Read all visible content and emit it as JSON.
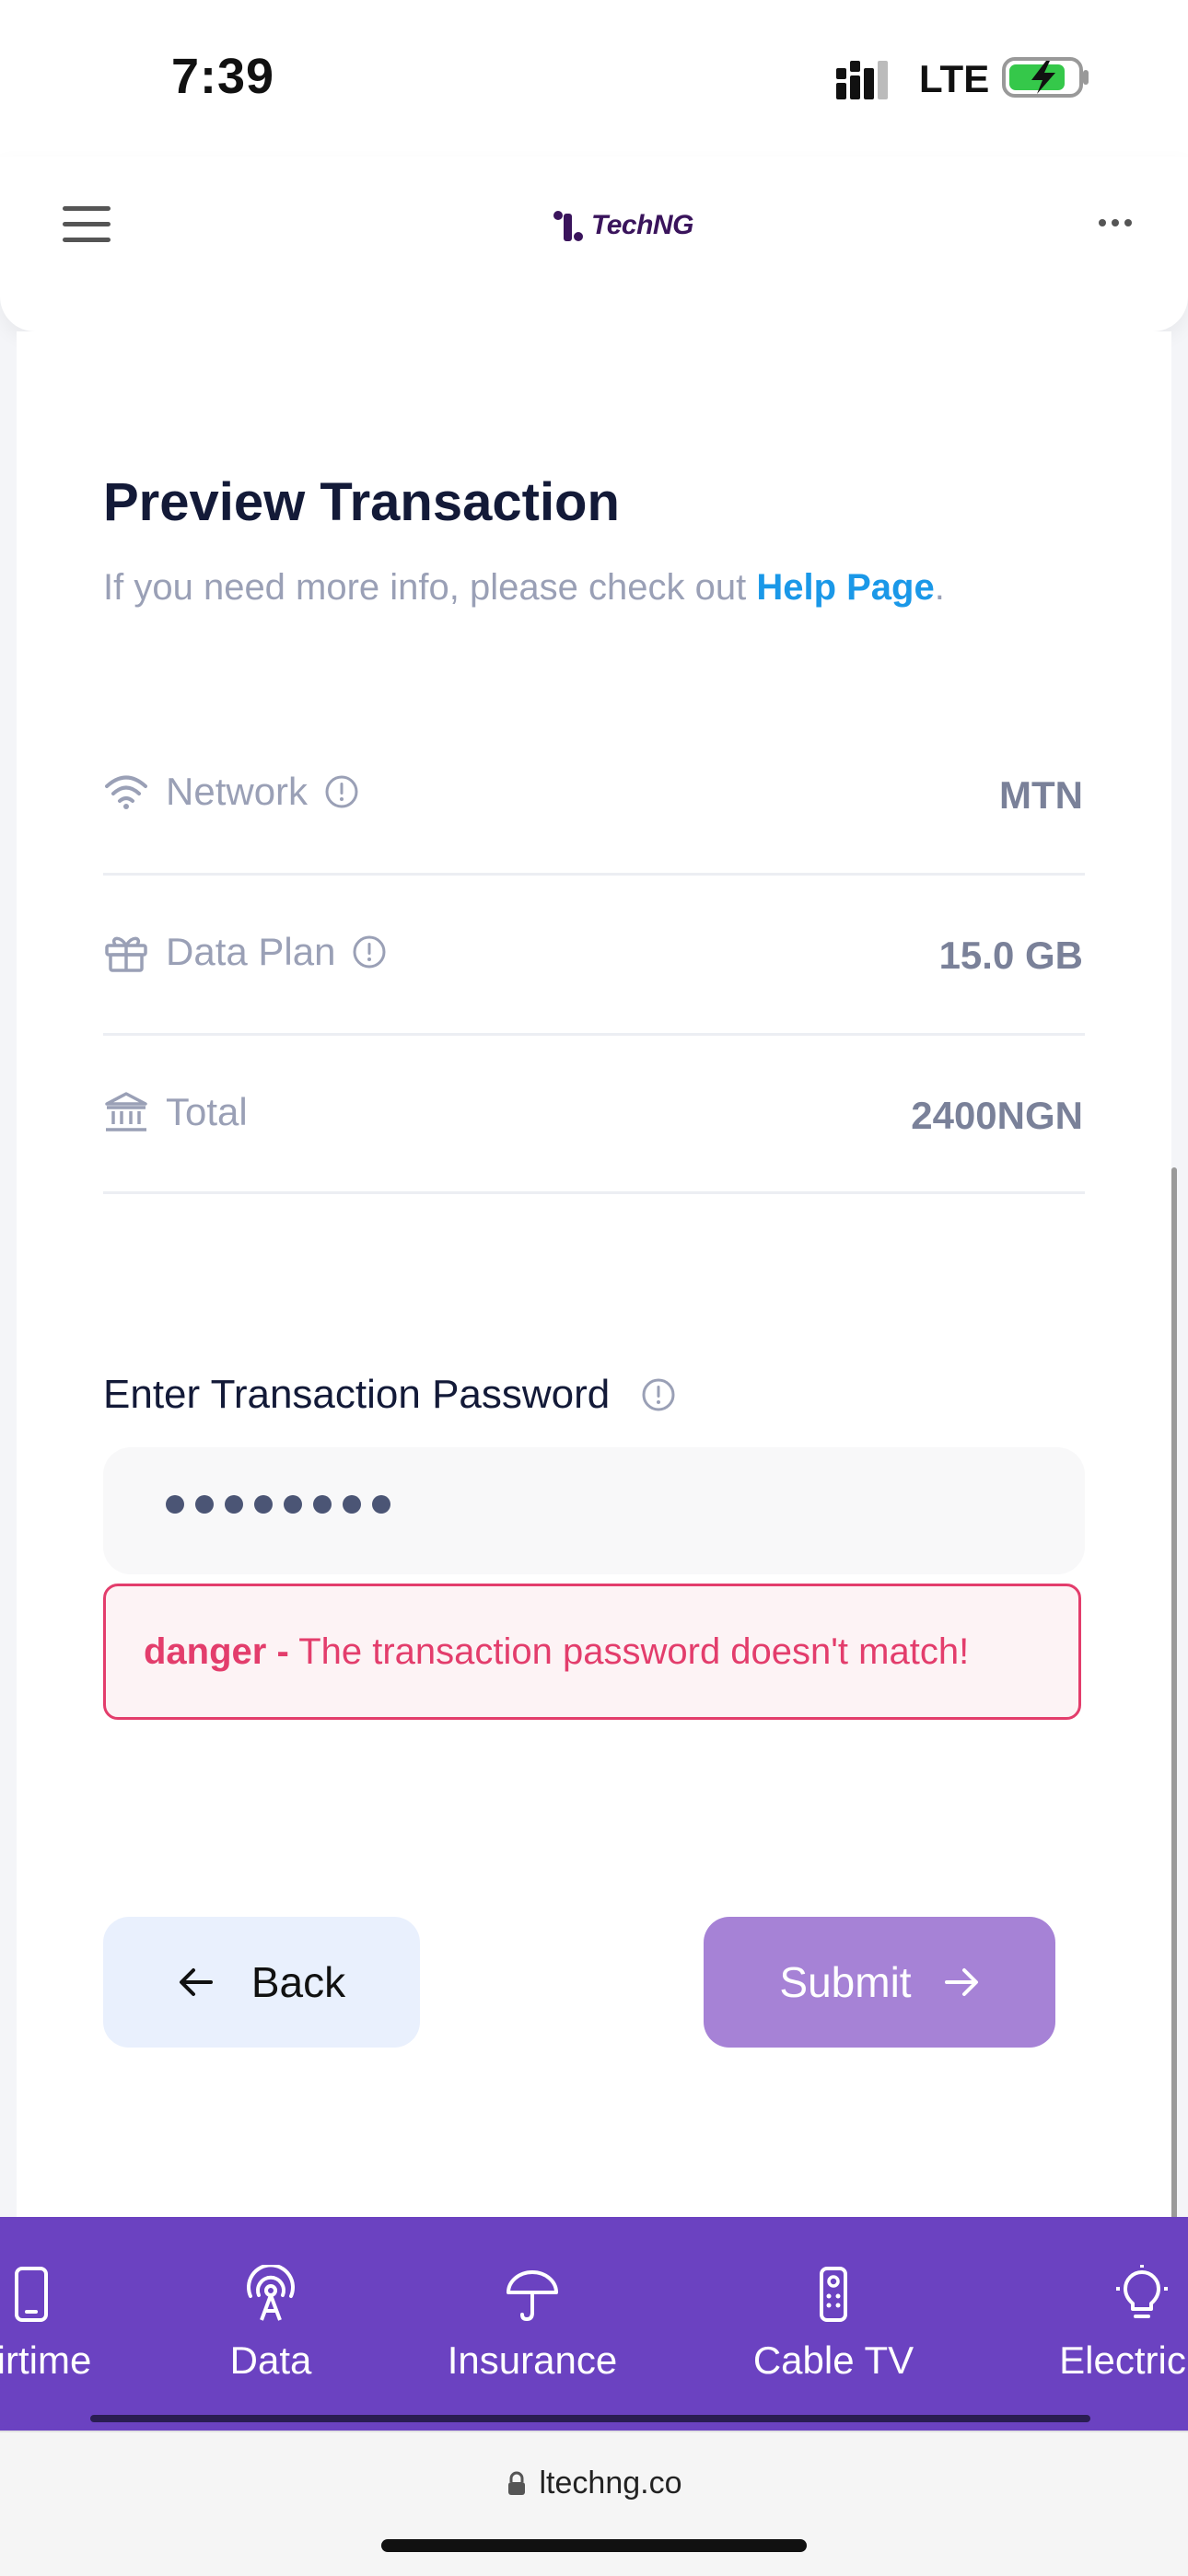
{
  "status_bar": {
    "time": "7:39",
    "network": "LTE",
    "battery_icon": "battery-charging-icon",
    "signal_icon": "cellular-signal-icon"
  },
  "header": {
    "logo_text": "TechNG",
    "menu_icon": "hamburger-menu-icon",
    "more_icon": "more-dots-icon"
  },
  "page": {
    "title": "Preview Transaction",
    "subtitle_prefix": "If you need more info, please check out",
    "help_link": "Help Page",
    "subtitle_suffix": "."
  },
  "details": [
    {
      "label": "Network",
      "value": "MTN",
      "icon": "wifi-icon",
      "info": true
    },
    {
      "label": "Data Plan",
      "value": "15.0 GB",
      "icon": "gift-icon",
      "info": true
    },
    {
      "label": "Total",
      "value": "2400NGN",
      "icon": "bank-icon",
      "info": false
    }
  ],
  "password": {
    "label": "Enter Transaction Password",
    "masked_value": "••••••••"
  },
  "alert": {
    "prefix": "danger -",
    "message": "The transaction password doesn't match!"
  },
  "actions": {
    "back_label": "Back",
    "submit_label": "Submit"
  },
  "bottom_nav": [
    {
      "label": "Airtime",
      "icon": "phone-icon"
    },
    {
      "label": "Data",
      "icon": "broadcast-icon"
    },
    {
      "label": "Insurance",
      "icon": "umbrella-icon"
    },
    {
      "label": "Cable TV",
      "icon": "remote-icon"
    },
    {
      "label": "Electricity",
      "icon": "lightbulb-icon"
    }
  ],
  "browser": {
    "url": "ltechng.co"
  },
  "colors": {
    "accent": "#6b42c1",
    "submit": "#a682d6",
    "danger": "#e33d6c",
    "link": "#1a98e8"
  }
}
